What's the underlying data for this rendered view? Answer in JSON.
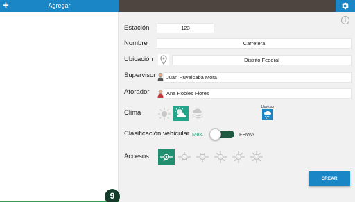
{
  "left_panel": {
    "title": "Agregar",
    "add_icon": "plus-icon"
  },
  "header": {
    "settings_icon": "gear-icon",
    "info_icon": "info-icon"
  },
  "form": {
    "estacion": {
      "label": "Estación",
      "value": "123"
    },
    "nombre": {
      "label": "Nombre",
      "value": "Carretera"
    },
    "ubicacion": {
      "label": "Ubicación",
      "value": "Distrito Federal",
      "icon": "location-pin-icon"
    },
    "supervisor": {
      "label": "Supervisor",
      "value": "Juan Ruvalcaba Mora",
      "icon": "person-icon"
    },
    "aforador": {
      "label": "Aforador",
      "value": "Ana Robles Flores",
      "icon": "person-icon"
    },
    "clima": {
      "label": "Clima",
      "options": [
        "sunny-icon",
        "partly-cloudy-icon",
        "fog-icon"
      ],
      "selected_index": 1,
      "extra_label": "Lluvioso",
      "extra_icon": "rain-icon"
    },
    "clasificacion": {
      "label": "Clasificación vehicular",
      "left_option": "Méx.",
      "right_option": "FHWA",
      "selected": "FHWA"
    },
    "accesos": {
      "label": "Accesos",
      "options": [
        "access-1-icon",
        "access-2-icon",
        "access-3-icon",
        "access-4-icon",
        "access-5-icon",
        "access-6-icon"
      ],
      "selected_index": 0
    },
    "create_label": "CREAR"
  },
  "colors": {
    "accent_blue": "#1a86c6",
    "accent_green": "#22a58a",
    "toggle_green": "#1d5a40",
    "top_bar": "#4f4540"
  },
  "fab_label": "9"
}
